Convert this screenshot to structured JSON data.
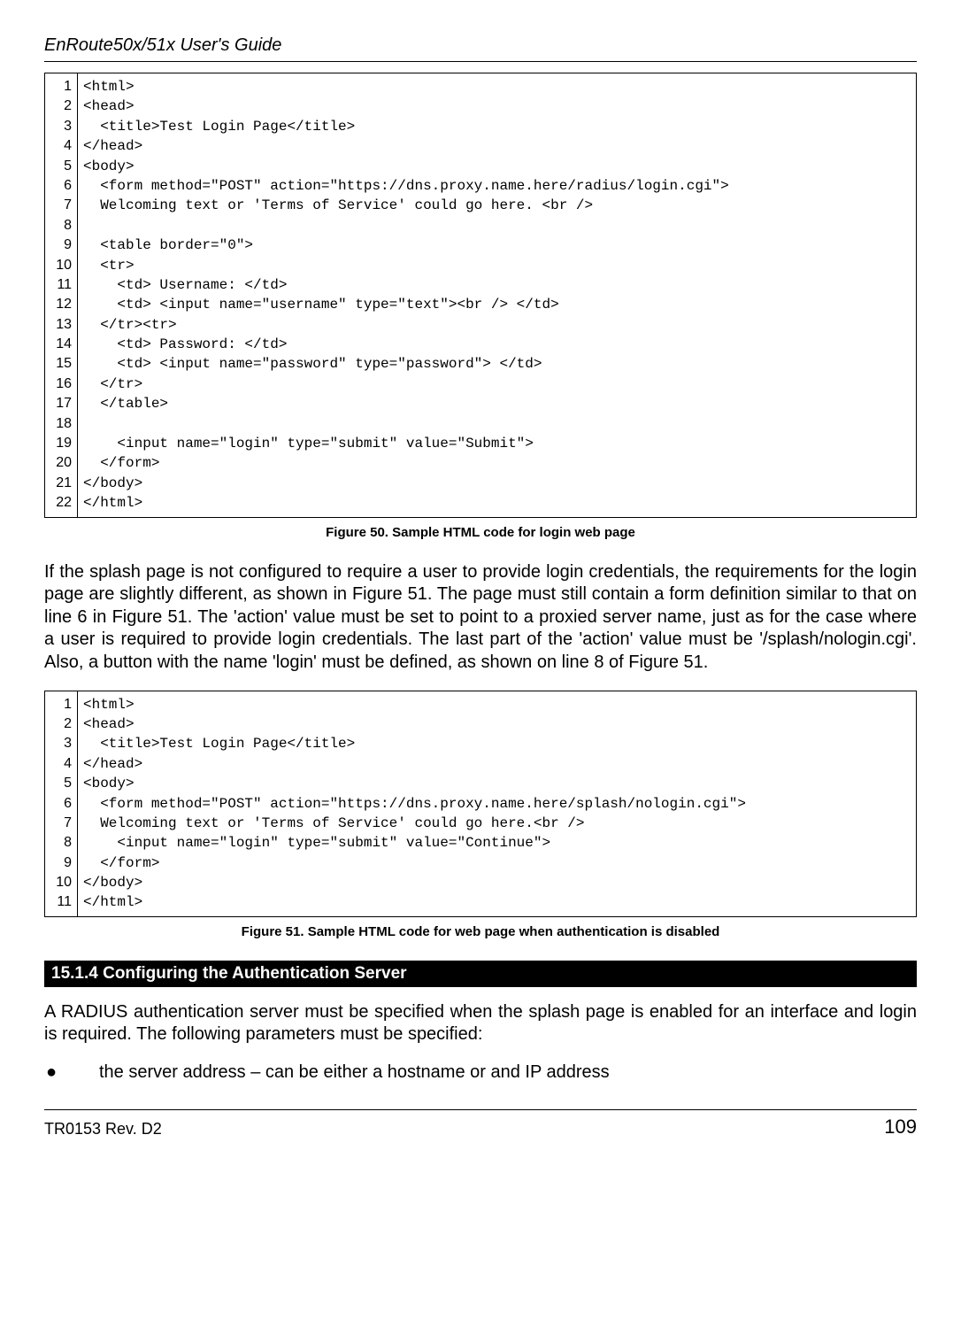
{
  "header_title": "EnRoute50x/51x User's Guide",
  "code_block_1": {
    "line_numbers": "1\n2\n3\n4\n5\n6\n7\n8\n9\n10\n11\n12\n13\n14\n15\n16\n17\n18\n19\n20\n21\n22",
    "content": "<html>\n<head>\n  <title>Test Login Page</title>\n</head>\n<body>\n  <form method=\"POST\" action=\"https://dns.proxy.name.here/radius/login.cgi\">\n  Welcoming text or 'Terms of Service' could go here. <br />\n\n  <table border=\"0\">\n  <tr>\n    <td> Username: </td>\n    <td> <input name=\"username\" type=\"text\"><br /> </td>\n  </tr><tr>\n    <td> Password: </td>\n    <td> <input name=\"password\" type=\"password\"> </td>\n  </tr>\n  </table>\n\n    <input name=\"login\" type=\"submit\" value=\"Submit\">\n  </form>\n</body>\n</html>"
  },
  "figure_50_caption": "Figure 50. Sample HTML code for login web page",
  "paragraph_1": "If the splash page is not configured to require a user to provide login credentials, the requirements for the login page are slightly different, as shown in Figure 51. The page must still contain a form definition similar to that on line 6 in Figure 51. The 'action' value must be set to point to a proxied server name, just as for the case where a user is required to provide login credentials. The last part of the 'action' value must be '/splash/nologin.cgi'. Also, a button with the name 'login' must be defined, as shown on line 8 of Figure 51.",
  "code_block_2": {
    "line_numbers": "1\n2\n3\n4\n5\n6\n7\n8\n9\n10\n11",
    "content": "<html>\n<head>\n  <title>Test Login Page</title>\n</head>\n<body>\n  <form method=\"POST\" action=\"https://dns.proxy.name.here/splash/nologin.cgi\">\n  Welcoming text or 'Terms of Service' could go here.<br />\n    <input name=\"login\" type=\"submit\" value=\"Continue\">\n  </form>\n</body>\n</html>"
  },
  "figure_51_caption": "Figure 51. Sample HTML code for web page when authentication is disabled",
  "section_header": "15.1.4    Configuring the Authentication Server",
  "paragraph_2": "A RADIUS authentication server must be specified when the splash page is enabled for an interface and login is required. The following parameters must be specified:",
  "bullet_1": "the server address – can be either a hostname or and IP address",
  "footer_left": "TR0153 Rev. D2",
  "footer_right": "109"
}
